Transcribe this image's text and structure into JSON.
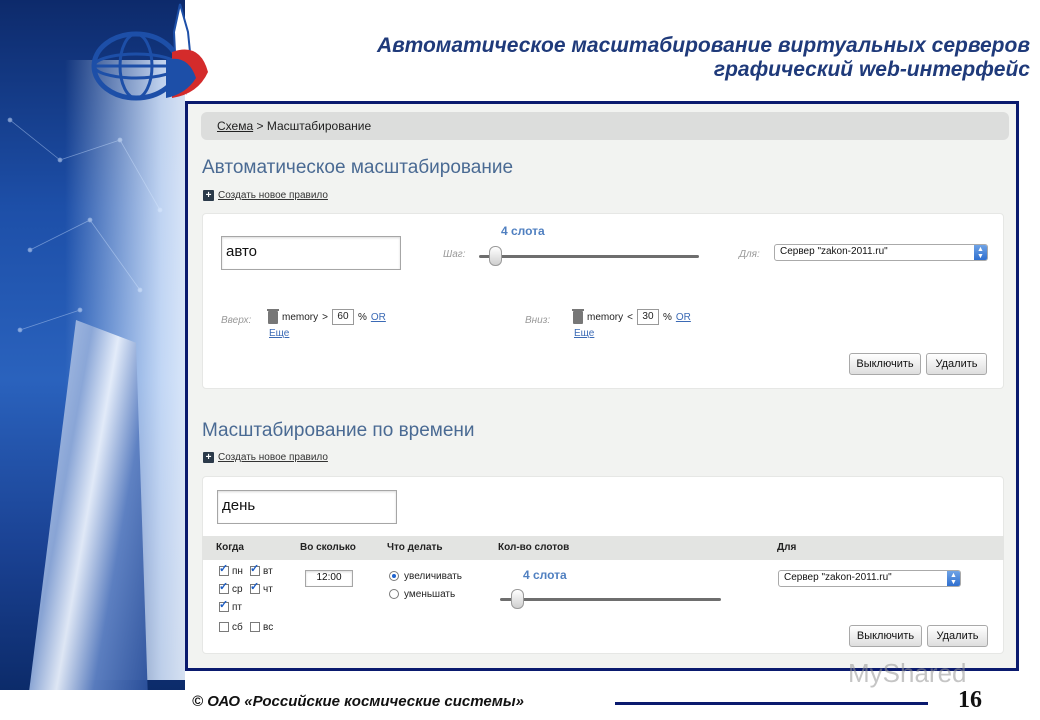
{
  "title": {
    "line1": "Автоматическое масштабирование виртуальных серверов",
    "line2": "графический web-интерфейс"
  },
  "breadcrumb": {
    "link": "Схема",
    "separator": ">",
    "current": "Масштабирование"
  },
  "auto_section": {
    "heading": "Автоматическое масштабирование",
    "add_rule": "Создать новое правило",
    "rule_name": "авто",
    "step_label": "Шаг:",
    "slots_label": "4 слота",
    "for_label": "Для:",
    "server_select": "Сервер \"zakon-2011.ru\"",
    "up_label": "Вверх:",
    "up_condition": {
      "metric": "memory",
      "operator": ">",
      "value": "60",
      "unit": "%",
      "or_link": "OR",
      "more": "Еще"
    },
    "down_label": "Вниз:",
    "down_condition": {
      "metric": "memory",
      "operator": "<",
      "value": "30",
      "unit": "%",
      "or_link": "OR",
      "more": "Еще"
    },
    "disable_button": "Выключить",
    "delete_button": "Удалить"
  },
  "time_section": {
    "heading": "Масштабирование по времени",
    "add_rule": "Создать новое правило",
    "rule_name": "день",
    "columns": [
      "Когда",
      "Во сколько",
      "Что делать",
      "Кол-во слотов",
      "Для"
    ],
    "days": [
      {
        "label": "пн",
        "checked": true
      },
      {
        "label": "вт",
        "checked": true
      },
      {
        "label": "ср",
        "checked": true
      },
      {
        "label": "чт",
        "checked": true
      },
      {
        "label": "пт",
        "checked": true
      },
      {
        "label": "сб",
        "checked": false
      },
      {
        "label": "вс",
        "checked": false
      }
    ],
    "time_value": "12:00",
    "action_increase": "увеличивать",
    "action_decrease": "уменьшать",
    "selected_action": "увеличивать",
    "slots_label": "4 слота",
    "server_select": "Сервер \"zakon-2011.ru\"",
    "disable_button": "Выключить",
    "delete_button": "Удалить"
  },
  "footer": {
    "company": "© ОАО «Российские космические системы»",
    "page_number": "16"
  },
  "watermark": "MyShared",
  "colors": {
    "accent": "#0a1a6e",
    "heading": "#4a6a93",
    "link": "#3b6ab5",
    "slot_label": "#4f7fc0"
  }
}
